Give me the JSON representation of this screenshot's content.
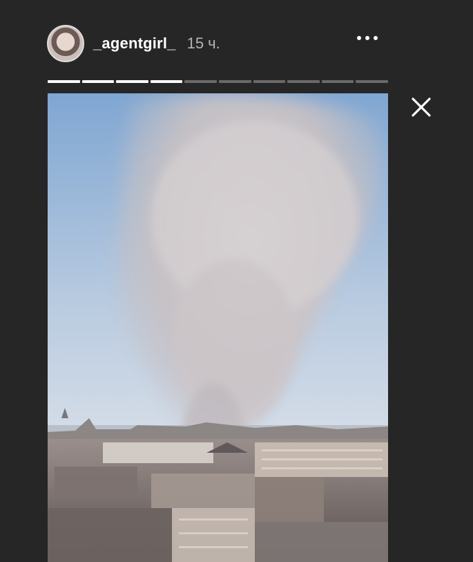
{
  "story": {
    "username": "_agentgirl_",
    "time": "15 ч.",
    "progress": {
      "segments": 10,
      "completed": 4,
      "current_fraction": 0.0
    }
  },
  "icons": {
    "avatar": "avatar-image",
    "more": "more-options-icon",
    "close": "close-icon"
  },
  "colors": {
    "background": "#262626",
    "progress_done": "#ffffff",
    "progress_pending": "#6a6a6a",
    "sky_top": "#8fb1d6",
    "sky_bottom": "#d7dfe8",
    "smoke": "#c9c4c6"
  }
}
